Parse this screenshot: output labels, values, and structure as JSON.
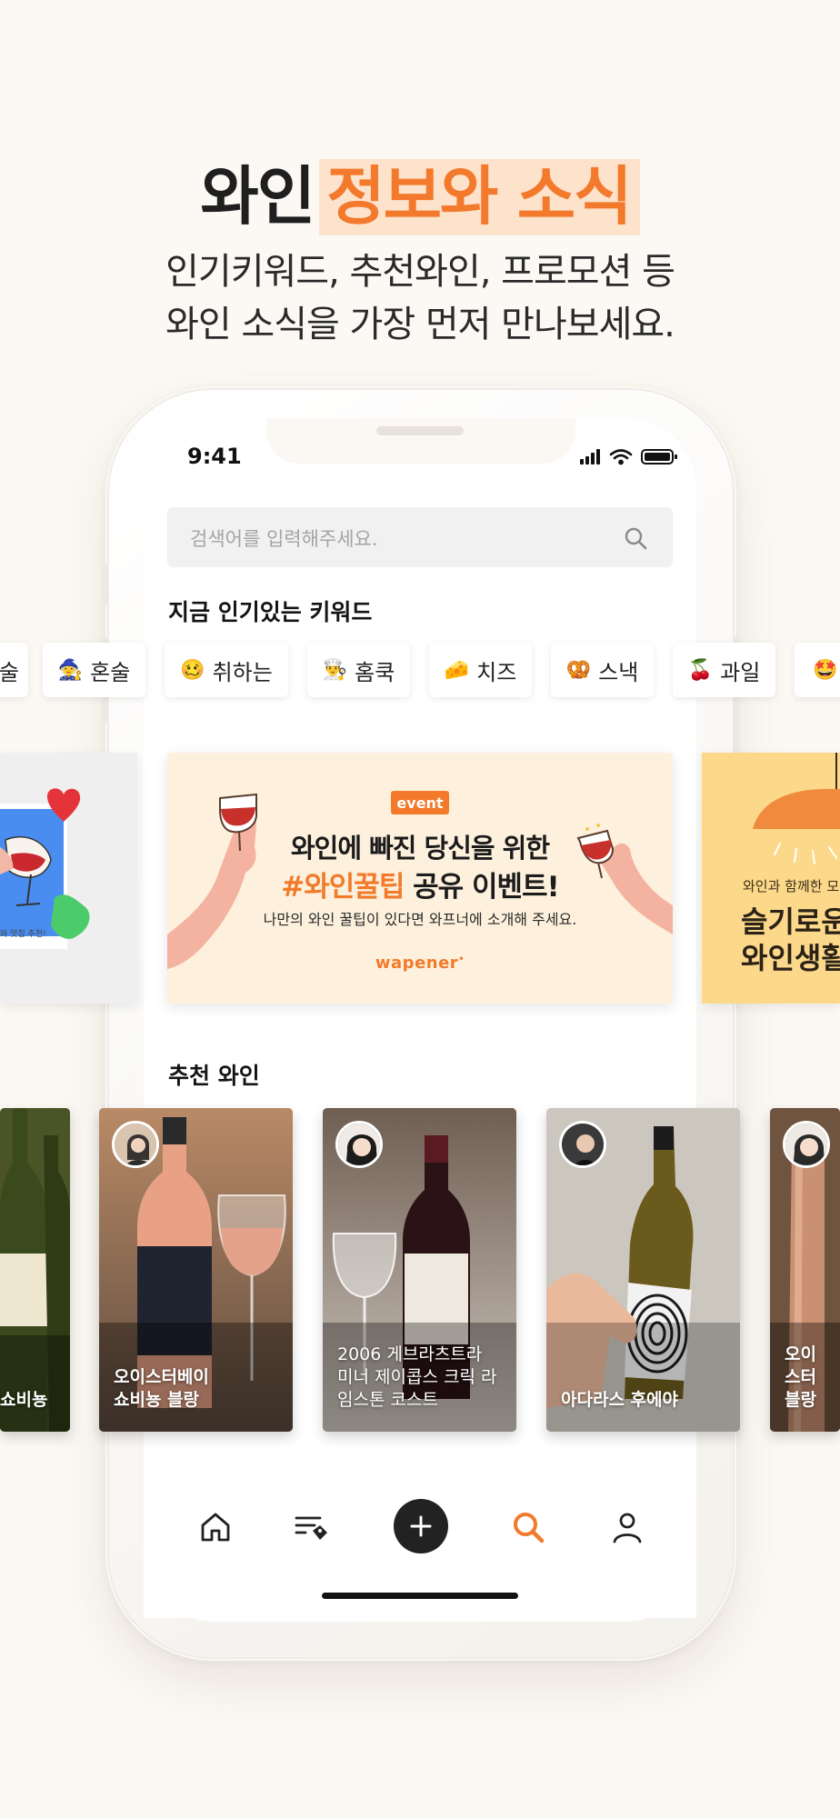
{
  "headline": {
    "plain": "와인",
    "highlight": "정보와 소식"
  },
  "subtitle": {
    "line1": "인기키워드, 추천와인, 프로모션 등",
    "line2": "와인 소식을 가장 먼저 만나보세요."
  },
  "status_bar": {
    "time": "9:41"
  },
  "search": {
    "placeholder": "검색어를 입력해주세요."
  },
  "keywords": {
    "title": "지금 인기있는 키워드",
    "items": [
      {
        "emoji": "",
        "label": "술"
      },
      {
        "emoji": "🧙",
        "label": "혼술"
      },
      {
        "emoji": "🥴",
        "label": "취하는"
      },
      {
        "emoji": "👨‍🍳",
        "label": "홈쿡"
      },
      {
        "emoji": "🧀",
        "label": "치즈"
      },
      {
        "emoji": "🥨",
        "label": "스낵"
      },
      {
        "emoji": "🍒",
        "label": "과일"
      },
      {
        "emoji": "🤩",
        "label": ""
      }
    ]
  },
  "banners": {
    "left_caption": "와 맛집 추천!",
    "main": {
      "badge": "event",
      "line1": "와인에 빠진 당신을 위한",
      "line2_tag": "#와인꿀팁",
      "line2_rest": " 공유 이벤트!",
      "line3": "나만의 와인 꿀팁이 있다면 와프너에 소개해 주세요.",
      "brand": "wapener"
    },
    "right": {
      "small": "와인과 함께한 모든",
      "big_line1": "슬기로운",
      "big_line2": "와인생활"
    }
  },
  "recommended": {
    "title": "추천 와인",
    "cards": [
      {
        "label": "쇼비뇽"
      },
      {
        "label": "오이스터베이\n쇼비뇽 블랑"
      },
      {
        "label": "2006 게브라츠트라\n미너 제이콥스 크릭 라\n임스톤 코스트"
      },
      {
        "label": "아다라스 후에야"
      },
      {
        "label": "오이스터\n블랑"
      }
    ]
  },
  "tabbar": {
    "items": [
      "home-icon",
      "wine-note-icon",
      "plus-icon",
      "search-icon",
      "profile-icon"
    ],
    "active": "search-icon"
  },
  "colors": {
    "accent": "#f37a2c",
    "accent_light": "#fde2cc",
    "background": "#fcf9f4"
  }
}
